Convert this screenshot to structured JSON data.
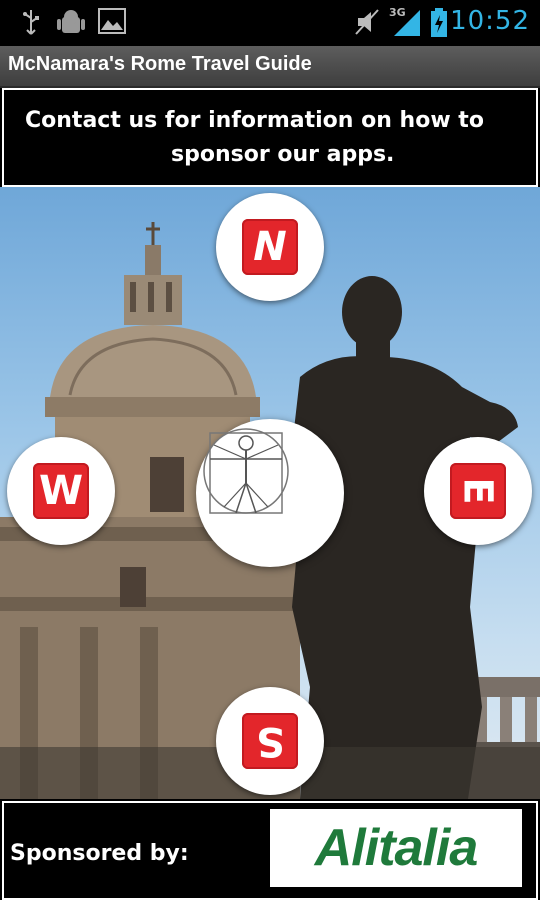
{
  "status_bar": {
    "time": "10:52",
    "network_label": "3G",
    "icons": [
      "usb-icon",
      "android-debug-icon",
      "image-notification-icon",
      "mute-icon",
      "signal-icon",
      "battery-icon"
    ],
    "accent_color": "#33b5e5"
  },
  "app": {
    "title": "McNamara's Rome Travel Guide"
  },
  "banner": {
    "line1": "Contact us for information on how to",
    "line2": "sponsor our apps."
  },
  "menu": {
    "buttons": [
      {
        "name": "north",
        "letter": "N"
      },
      {
        "name": "west",
        "letter": "W"
      },
      {
        "name": "east",
        "letter": "E"
      },
      {
        "name": "south",
        "letter": "S"
      }
    ],
    "center_icon": "vitruvian-man-icon",
    "tile_color": "#e3262b"
  },
  "sponsor": {
    "label": "Sponsored by:",
    "brand": "Alitalia",
    "brand_color": "#1f7a3b"
  }
}
